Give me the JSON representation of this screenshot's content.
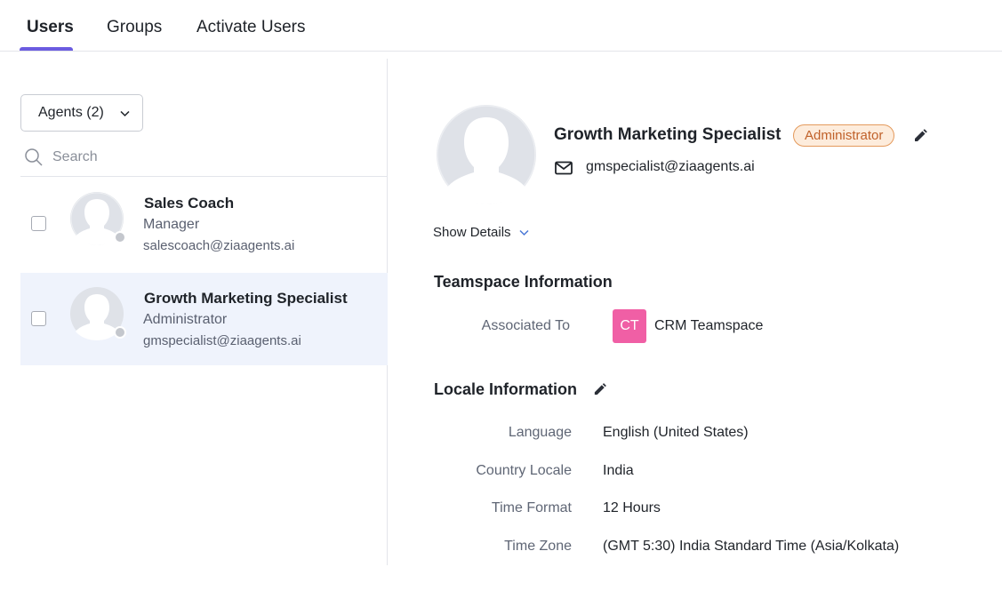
{
  "tabs": [
    {
      "label": "Users",
      "active": true
    },
    {
      "label": "Groups",
      "active": false
    },
    {
      "label": "Activate Users",
      "active": false
    }
  ],
  "accent_color": "#6b5ce0",
  "left_panel": {
    "filter_label": "Agents (2)",
    "search_placeholder": "Search",
    "users": [
      {
        "name": "Sales Coach",
        "role": "Manager",
        "email": "salescoach@ziaagents.ai",
        "selected": false
      },
      {
        "name": "Growth Marketing Specialist",
        "role": "Administrator",
        "email": "gmspecialist@ziaagents.ai",
        "selected": true
      }
    ]
  },
  "profile": {
    "name": "Growth Marketing Specialist",
    "role_badge": "Administrator",
    "email": "gmspecialist@ziaagents.ai",
    "show_details": "Show Details"
  },
  "teamspace": {
    "title": "Teamspace Information",
    "associated_label": "Associated To",
    "badge_initials": "CT",
    "badge_color": "#f05fa5",
    "name": "CRM Teamspace"
  },
  "locale": {
    "title": "Locale Information",
    "fields": [
      {
        "label": "Language",
        "value": "English (United States)"
      },
      {
        "label": "Country Locale",
        "value": "India"
      },
      {
        "label": "Time Format",
        "value": "12 Hours"
      },
      {
        "label": "Time Zone",
        "value": "(GMT 5:30) India Standard Time (Asia/Kolkata)"
      }
    ]
  }
}
